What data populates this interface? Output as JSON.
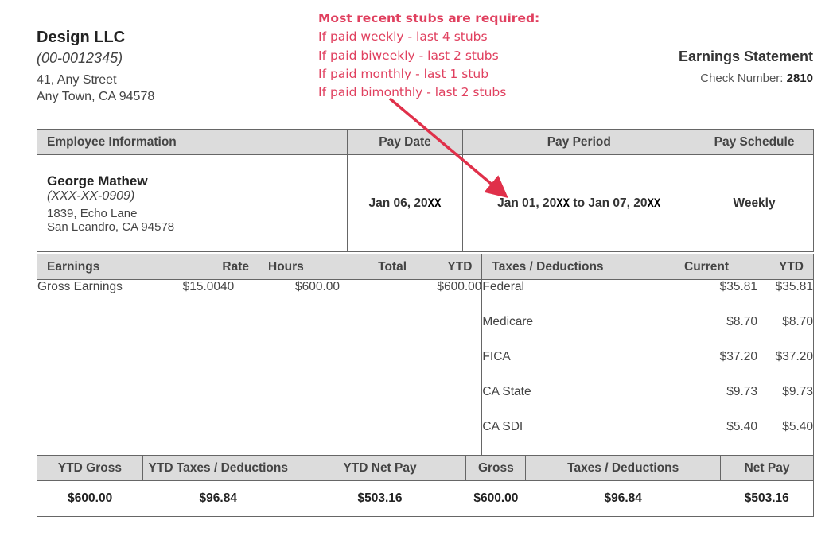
{
  "company": {
    "name": "Design LLC",
    "id": "(00-0012345)",
    "address_line1": "41, Any Street",
    "address_line2": "Any Town, CA 94578"
  },
  "note": {
    "title": "Most recent stubs are required:",
    "lines": [
      "If paid weekly - last 4 stubs",
      "If paid biweekly - last 2 stubs",
      "If paid monthly - last 1 stub",
      "If paid bimonthly - last 2 stubs"
    ],
    "color": "#e0405f"
  },
  "statement": {
    "title": "Earnings Statement",
    "check_label": "Check Number:",
    "check_number": "2810"
  },
  "info_headers": {
    "employee": "Employee Information",
    "pay_date": "Pay Date",
    "pay_period": "Pay Period",
    "pay_schedule": "Pay Schedule"
  },
  "employee": {
    "name": "George Mathew",
    "ssn": "(XXX-XX-0909)",
    "address_line1": "1839, Echo Lane",
    "address_line2": "San Leandro, CA 94578"
  },
  "pay": {
    "date_prefix": "Jan 06, 20",
    "date_suffix": "XX",
    "period_start_prefix": "Jan 01, 20",
    "period_start_suffix": "XX",
    "period_to": "to",
    "period_end_prefix": "Jan 07, 20",
    "period_end_suffix": "XX",
    "schedule": "Weekly"
  },
  "earnings_headers": {
    "earnings": "Earnings",
    "rate": "Rate",
    "hours": "Hours",
    "total": "Total",
    "ytd": "YTD",
    "taxes": "Taxes / Deductions",
    "current": "Current",
    "taxes_ytd": "YTD"
  },
  "earnings": [
    {
      "label": "Gross Earnings",
      "rate": "$15.00",
      "hours": "40",
      "total": "$600.00",
      "ytd": "$600.00"
    }
  ],
  "taxes": [
    {
      "label": "Federal",
      "current": "$35.81",
      "ytd": "$35.81"
    },
    {
      "label": "Medicare",
      "current": "$8.70",
      "ytd": "$8.70"
    },
    {
      "label": "FICA",
      "current": "$37.20",
      "ytd": "$37.20"
    },
    {
      "label": "CA State",
      "current": "$9.73",
      "ytd": "$9.73"
    },
    {
      "label": "CA SDI",
      "current": "$5.40",
      "ytd": "$5.40"
    }
  ],
  "summary_headers": {
    "ytd_gross": "YTD Gross",
    "ytd_taxes": "YTD Taxes / Deductions",
    "ytd_net": "YTD Net Pay",
    "gross": "Gross",
    "taxes": "Taxes / Deductions",
    "net": "Net Pay"
  },
  "summary": {
    "ytd_gross": "$600.00",
    "ytd_taxes": "$96.84",
    "ytd_net": "$503.16",
    "gross": "$600.00",
    "taxes": "$96.84",
    "net": "$503.16"
  }
}
